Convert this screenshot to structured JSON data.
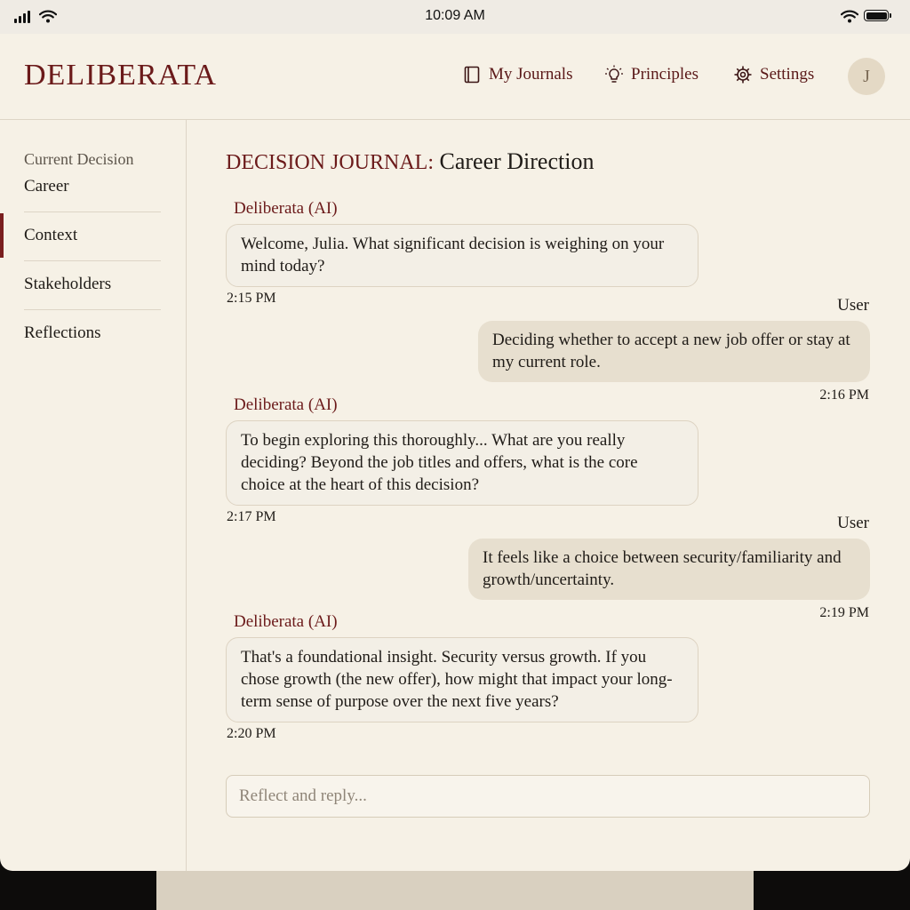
{
  "status_bar": {
    "time": "10:09 AM"
  },
  "header": {
    "logo": "DELIBERATA",
    "nav": [
      {
        "label": "My Journals",
        "icon": "book-icon"
      },
      {
        "label": "Principles",
        "icon": "lightbulb-icon"
      },
      {
        "label": "Settings",
        "icon": "gear-icon"
      }
    ],
    "avatar_initial": "J"
  },
  "sidebar": {
    "current_label": "Current Decision",
    "current_value": "Career",
    "items": [
      {
        "label": "Context",
        "active": true
      },
      {
        "label": "Stakeholders",
        "active": false
      },
      {
        "label": "Reflections",
        "active": false
      }
    ]
  },
  "main": {
    "title_kicker": "DECISION JOURNAL:",
    "title": "Career Direction",
    "messages": [
      {
        "sender": "Deliberata (AI)",
        "role": "ai",
        "text": "Welcome, Julia. What significant decision is weighing on your mind today?",
        "time": "2:15 PM"
      },
      {
        "sender": "User",
        "role": "user",
        "text": "Deciding whether to accept a new job offer or stay at my current role.",
        "time": "2:16 PM"
      },
      {
        "sender": "Deliberata (AI)",
        "role": "ai",
        "text": "To begin exploring this thoroughly... What are you really deciding? Beyond the job titles and offers, what is the core choice at the heart of this decision?",
        "time": "2:17 PM"
      },
      {
        "sender": "User",
        "role": "user",
        "text": "It feels like a choice between security/familiarity and growth/uncertainty.",
        "time": "2:19 PM"
      },
      {
        "sender": "Deliberata (AI)",
        "role": "ai",
        "text": "That's a foundational insight. Security versus growth. If you chose growth (the new offer), how might that impact your long-term sense of purpose over the next five years?",
        "time": "2:20 PM"
      }
    ],
    "reply": {
      "placeholder": "Reflect and reply...",
      "value": ""
    }
  },
  "colors": {
    "accent": "#6b1a1a",
    "background": "#f6f1e6",
    "user_bubble": "#e7dfcf",
    "ai_bubble": "#f3efe6"
  }
}
